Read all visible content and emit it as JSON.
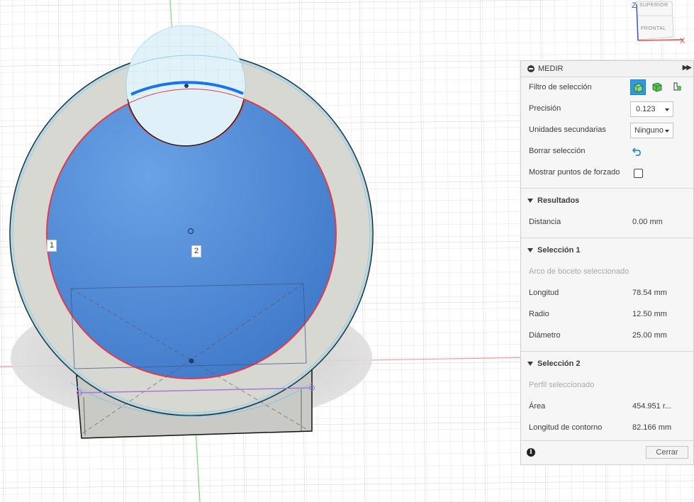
{
  "viewcube": {
    "top_face": "SUPERIOR",
    "front_face": "FRONTAL",
    "axis_z": "Z",
    "axis_x": "X"
  },
  "viewport": {
    "tag1": "1",
    "tag2": "2"
  },
  "panel": {
    "title": "MEDIR",
    "filter_label": "Filtro de selección",
    "precision_label": "Precisión",
    "precision_value": "0.123",
    "secondary_units_label": "Unidades secundarias",
    "secondary_units_value": "Ninguno",
    "clear_selection_label": "Borrar selección",
    "snap_points_label": "Mostrar puntos de forzado",
    "results": {
      "title": "Resultados",
      "distance_label": "Distancia",
      "distance_value": "0.00 mm"
    },
    "selection1": {
      "title": "Selección 1",
      "subtitle": "Arco de boceto seleccionado",
      "length_label": "Longitud",
      "length_value": "78.54 mm",
      "radius_label": "Radio",
      "radius_value": "12.50 mm",
      "diameter_label": "Diámetro",
      "diameter_value": "25.00 mm"
    },
    "selection2": {
      "title": "Selección 2",
      "subtitle": "Perfil seleccionado",
      "area_label": "Área",
      "area_value": "454.951 r...",
      "perimeter_label": "Longitud de contorno",
      "perimeter_value": "82.166 mm"
    },
    "close_label": "Cerrar"
  },
  "colors": {
    "accent": "#2e9be0",
    "profile_fill": "#4a86d4",
    "grid": "#dcdcdc"
  }
}
